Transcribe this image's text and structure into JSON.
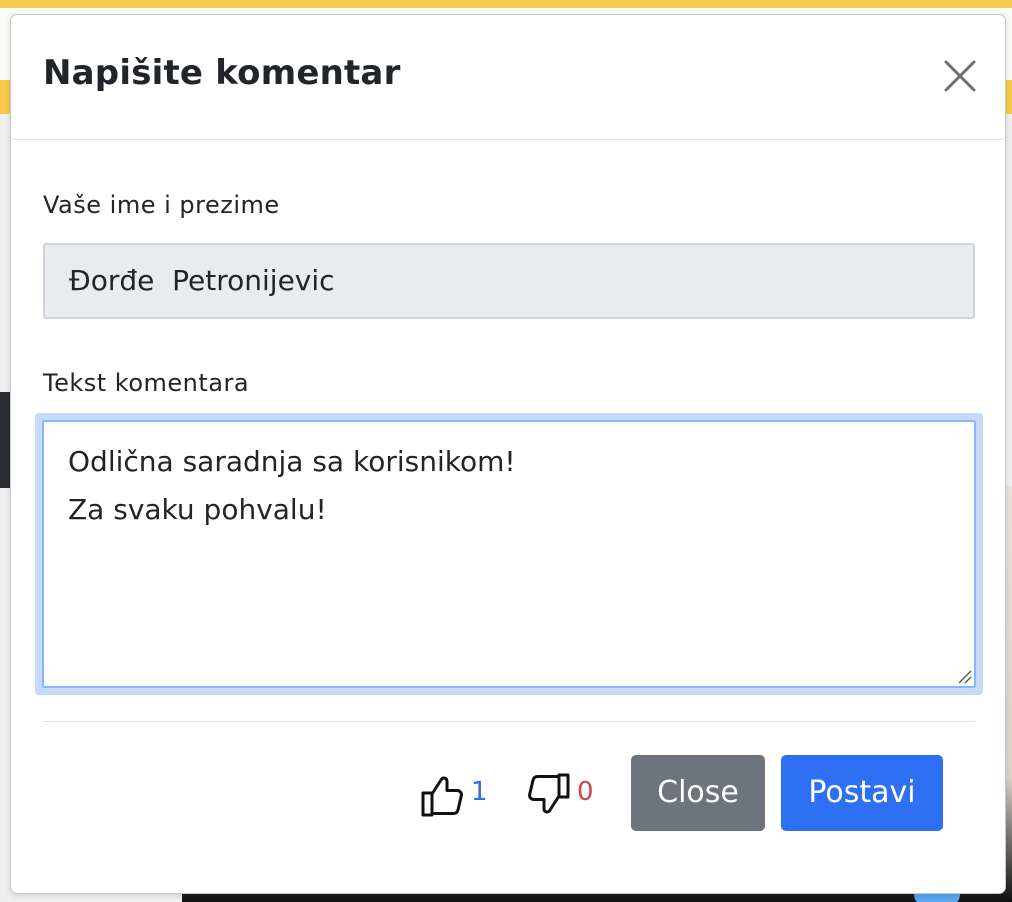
{
  "modal": {
    "title": "Napišite komentar",
    "close_icon": "close-icon"
  },
  "form": {
    "name_label": "Vaše ime i prezime",
    "name_value": "Đorđe  Petronijevic",
    "text_label": "Tekst komentara",
    "text_lines": [
      "Odlična saradnja sa korisnikom!",
      "Za svaku pohvalu!"
    ]
  },
  "votes": {
    "up_icon": "thumbs-up-icon",
    "up_count": "1",
    "down_icon": "thumbs-down-icon",
    "down_count": "0"
  },
  "buttons": {
    "close_label": "Close",
    "post_label": "Postavi"
  },
  "colors": {
    "primary": "#2f6ff3",
    "secondary": "#6c757d",
    "up_count": "#2f6fde",
    "down_count": "#c9474f",
    "focus_ring": "#c6dafc"
  }
}
